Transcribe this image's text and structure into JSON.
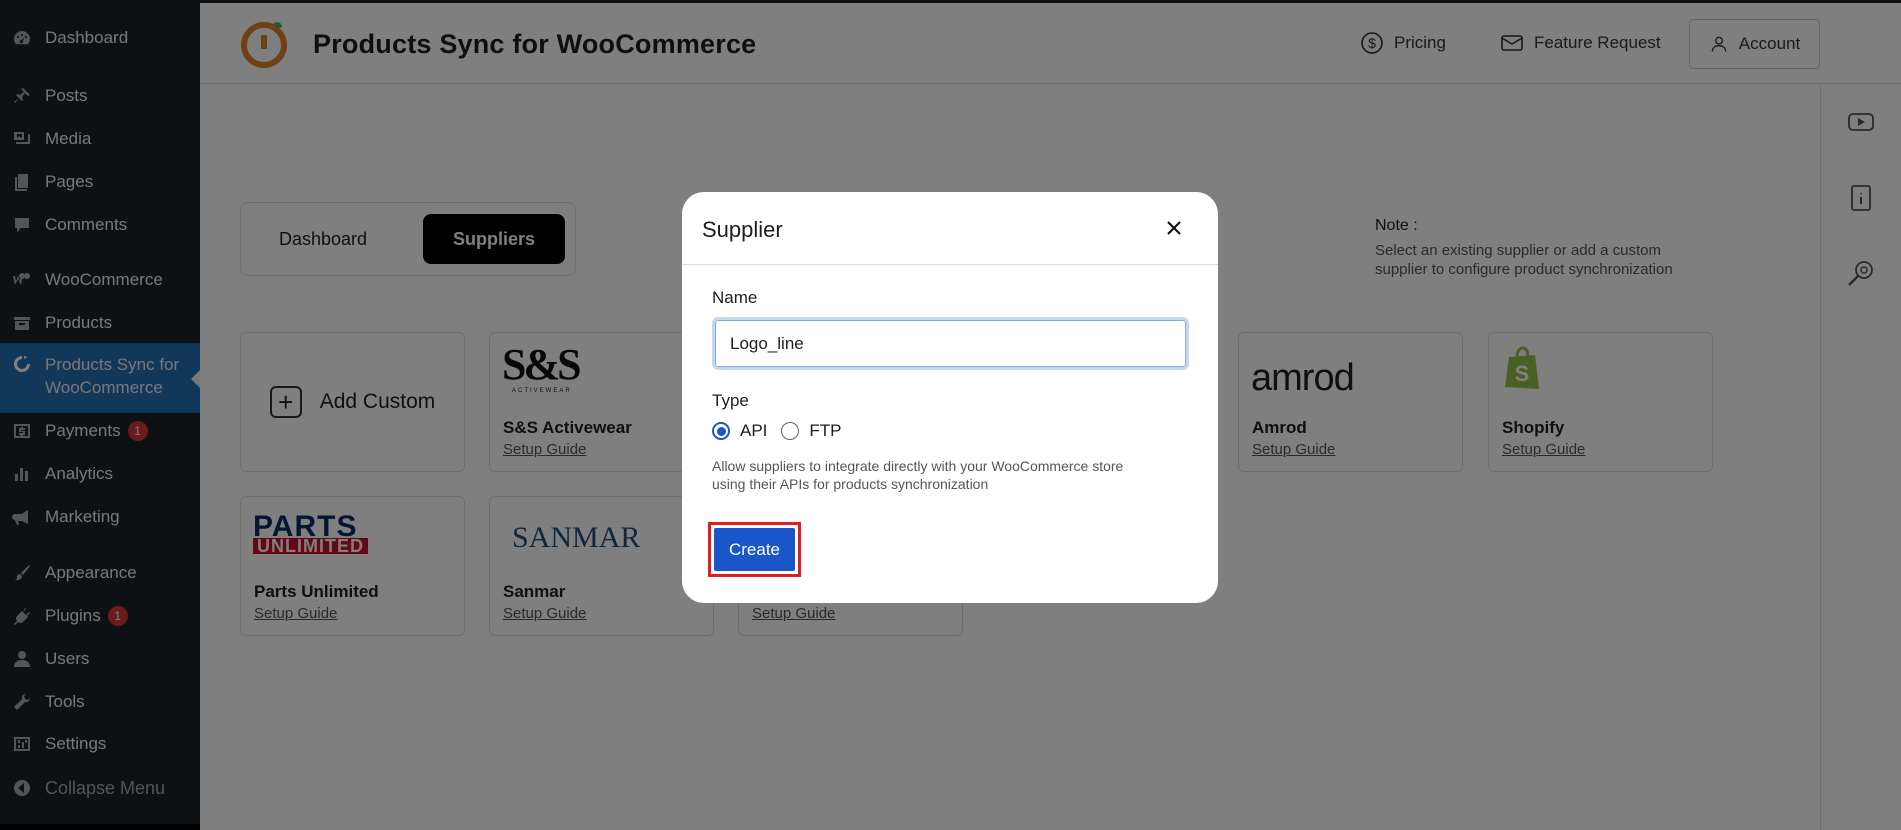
{
  "sidebar": {
    "items": [
      {
        "label": "Dashboard",
        "icon": "dashboard-icon"
      },
      {
        "label": "Posts",
        "icon": "pin-icon"
      },
      {
        "label": "Media",
        "icon": "media-icon"
      },
      {
        "label": "Pages",
        "icon": "pages-icon"
      },
      {
        "label": "Comments",
        "icon": "comments-icon"
      },
      {
        "label": "WooCommerce",
        "icon": "woocommerce-icon"
      },
      {
        "label": "Products",
        "icon": "archive-icon"
      },
      {
        "label": "Products Sync for WooCommerce",
        "icon": "sync-icon"
      },
      {
        "label": "Payments",
        "icon": "payments-icon",
        "badge": "1"
      },
      {
        "label": "Analytics",
        "icon": "analytics-icon"
      },
      {
        "label": "Marketing",
        "icon": "megaphone-icon"
      },
      {
        "label": "Appearance",
        "icon": "brush-icon"
      },
      {
        "label": "Plugins",
        "icon": "plugin-icon",
        "badge": "1"
      },
      {
        "label": "Users",
        "icon": "user-icon"
      },
      {
        "label": "Tools",
        "icon": "wrench-icon"
      },
      {
        "label": "Settings",
        "icon": "settings-icon"
      },
      {
        "label": "Collapse Menu",
        "icon": "collapse-icon"
      }
    ]
  },
  "header": {
    "title": "Products Sync for WooCommerce",
    "pricing": "Pricing",
    "feature_request": "Feature Request",
    "account": "Account"
  },
  "tabs": {
    "dashboard": "Dashboard",
    "suppliers": "Suppliers"
  },
  "note": {
    "title": "Note :",
    "text": "Select an existing supplier or add a custom supplier to configure product synchronization"
  },
  "cards": {
    "add_custom": "Add Custom",
    "setup_guide": "Setup Guide",
    "ss": {
      "name": "S&S Activewear",
      "logo": "S&S",
      "logo_sub": "ACTIVEWEAR"
    },
    "amrod": {
      "name": "Amrod",
      "logo": "amrod"
    },
    "shopify": {
      "name": "Shopify"
    },
    "parts": {
      "name": "Parts Unlimited",
      "logo_top": "PARTS",
      "logo_bottom": "UNLIMITED"
    },
    "sanmar": {
      "name": "Sanmar",
      "logo": "SANMAR"
    }
  },
  "modal": {
    "title": "Supplier",
    "name_label": "Name",
    "name_value": "Logo_line",
    "type_label": "Type",
    "type_options": [
      "API",
      "FTP"
    ],
    "type_selected": "API",
    "help": "Allow suppliers to integrate directly with your WooCommerce store using their APIs for products synchronization",
    "create": "Create"
  },
  "colors": {
    "sidebar_bg": "#1d2327",
    "sidebar_active": "#2271b1",
    "primary": "#1a56c7",
    "highlight": "#e01b24",
    "badge": "#d63638"
  }
}
